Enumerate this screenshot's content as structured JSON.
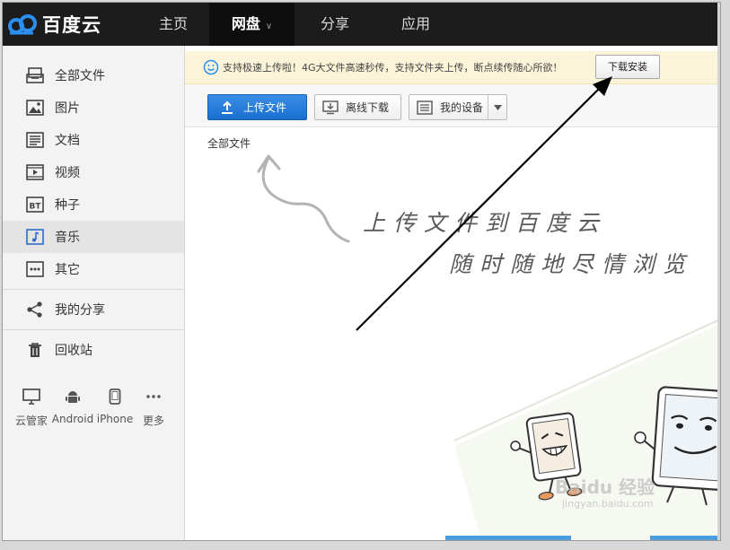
{
  "logo": {
    "text": "百度云"
  },
  "nav": [
    {
      "label": "主页"
    },
    {
      "label": "网盘",
      "active": true
    },
    {
      "label": "分享"
    },
    {
      "label": "应用"
    }
  ],
  "sidebar": {
    "items": [
      {
        "label": "全部文件",
        "icon": "all-files-icon"
      },
      {
        "label": "图片",
        "icon": "image-icon"
      },
      {
        "label": "文档",
        "icon": "document-icon"
      },
      {
        "label": "视频",
        "icon": "video-icon"
      },
      {
        "label": "种子",
        "icon": "bt-icon"
      },
      {
        "label": "音乐",
        "icon": "music-icon",
        "active": true
      },
      {
        "label": "其它",
        "icon": "more-icon"
      }
    ],
    "share": {
      "label": "我的分享",
      "icon": "share-icon"
    },
    "trash": {
      "label": "回收站",
      "icon": "trash-icon"
    },
    "devices": [
      {
        "label": "云管家",
        "icon": "desktop-icon"
      },
      {
        "label": "Android",
        "icon": "android-icon"
      },
      {
        "label": "iPhone",
        "icon": "iphone-icon"
      },
      {
        "label": "更多",
        "icon": "more-icon"
      }
    ]
  },
  "notice": {
    "text": "支持极速上传啦！4G大文件高速秒传，支持文件夹上传，断点续传随心所欲！",
    "button": "下载安装"
  },
  "toolbar": {
    "upload": "上传文件",
    "offline": "离线下载",
    "device": "我的设备"
  },
  "breadcrumb": "全部文件",
  "empty_state": {
    "line1": "上传文件到百度云",
    "line2": "随时随地尽情浏览"
  },
  "watermark": {
    "brand": "Baidu 经验",
    "url": "jingyan.baidu.com"
  },
  "colors": {
    "topbar": "#1c1c1c",
    "accent_blue": "#1a6fcf",
    "notice_bg": "#fbf4d8"
  }
}
